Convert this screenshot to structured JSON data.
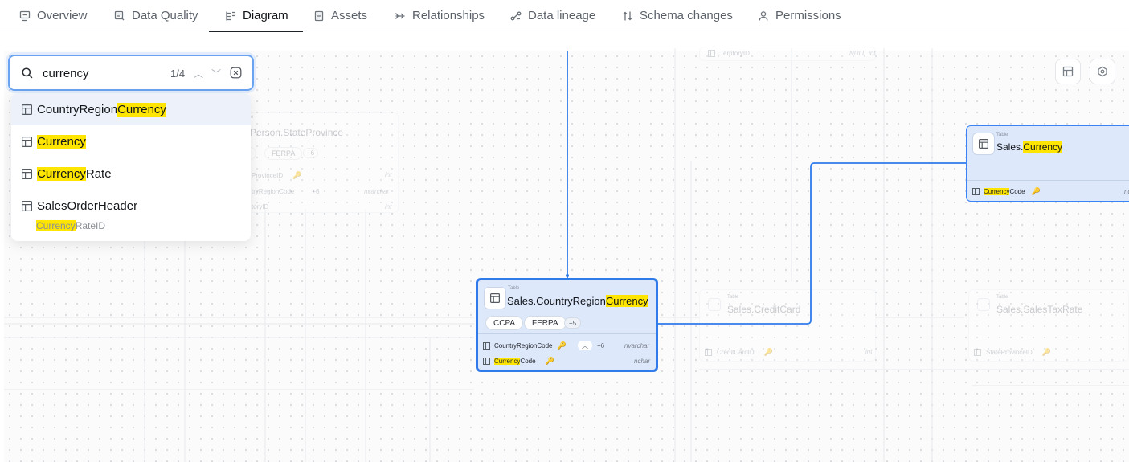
{
  "tabs": [
    {
      "label": "Overview",
      "icon": "overview-icon"
    },
    {
      "label": "Data Quality",
      "icon": "data-quality-icon"
    },
    {
      "label": "Diagram",
      "icon": "diagram-icon",
      "active": true
    },
    {
      "label": "Assets",
      "icon": "assets-icon"
    },
    {
      "label": "Relationships",
      "icon": "relationships-icon"
    },
    {
      "label": "Data lineage",
      "icon": "lineage-icon"
    },
    {
      "label": "Schema changes",
      "icon": "schema-changes-icon"
    },
    {
      "label": "Permissions",
      "icon": "permissions-icon"
    }
  ],
  "search": {
    "value": "currency",
    "count": "1/4",
    "results": [
      {
        "before": "CountryRegion",
        "match": "Currency",
        "after": ""
      },
      {
        "before": "",
        "match": "Currency",
        "after": ""
      },
      {
        "before": "",
        "match": "Currency",
        "after": "Rate"
      },
      {
        "before": "SalesOrderHeader",
        "match": "",
        "after": ""
      }
    ],
    "sub_result": {
      "match": "Currency",
      "after": "RateID"
    }
  },
  "main_node": {
    "kind": "Table",
    "title_before": "Sales.CountryRegion",
    "title_match": "Currency",
    "tags": [
      "CCPA",
      "FERPA"
    ],
    "more_tags": "+5",
    "columns": [
      {
        "name": "CountryRegionCode",
        "type": "nvarchar",
        "more": "+6"
      },
      {
        "name_match": "Currency",
        "name_after": "Code",
        "type": "nchar"
      }
    ]
  },
  "side_node": {
    "kind": "Table",
    "title_before": "Sales.",
    "title_match": "Currency",
    "column_match": "Currency",
    "column_after": "Code",
    "column_type": "nc"
  },
  "ghosts": {
    "state_province": {
      "title": "Person.StateProvince",
      "tag1": "A",
      "tag2": "FERPA",
      "more": "+6",
      "row1": "ProvinceID",
      "row1_type": "int",
      "row2": "tryRegionCode",
      "row2_more": "+6",
      "row2_type": "nvarchar",
      "row3": "toryID",
      "row3_type": "int",
      "kind": "able"
    },
    "territory": {
      "row": "TerritoryID",
      "type": "NULL",
      "type2": "int"
    },
    "credit_card": {
      "title": "Sales.CreditCard",
      "kind": "Table",
      "row": "CreditCardID",
      "type": "int"
    },
    "sales_tax": {
      "title": "Sales.SalesTaxRate",
      "kind": "Table",
      "row": "StateProvinceID"
    }
  },
  "colors": {
    "accent": "#2f7bea",
    "highlight": "#ffe500",
    "node_bg": "#dde8fb"
  }
}
